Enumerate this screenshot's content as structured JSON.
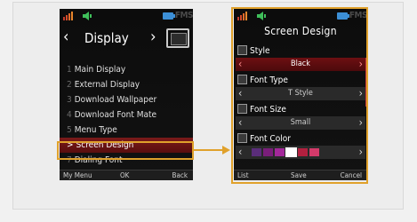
{
  "status": {
    "indicator": "FMS",
    "battery_icon": "battery-icon",
    "signal_icon": "signal-icon",
    "volume_icon": "speaker-icon"
  },
  "left": {
    "header": {
      "title": "Display",
      "prev_icon": "chevron-left-icon",
      "next_icon": "chevron-right-icon",
      "display_icon": "display-icon"
    },
    "menu": [
      {
        "num": "1",
        "label": "Main Display"
      },
      {
        "num": "2",
        "label": "External Display"
      },
      {
        "num": "3",
        "label": "Download Wallpaper"
      },
      {
        "num": "4",
        "label": "Download Font Mate"
      },
      {
        "num": "5",
        "label": "Menu Type"
      },
      {
        "num": ">",
        "label": "Screen Design",
        "selected": true
      },
      {
        "num": "7",
        "label": "Dialing Font"
      }
    ],
    "softkeys": {
      "left": "My Menu",
      "center": "OK",
      "right": "Back"
    }
  },
  "right": {
    "title": "Screen Design",
    "style": {
      "label": "Style",
      "value": "Black"
    },
    "font_type": {
      "label": "Font Type",
      "value": "T Style"
    },
    "font_size": {
      "label": "Font Size",
      "value": "Small"
    },
    "font_color": {
      "label": "Font Color",
      "colors": [
        "#5a2d7a",
        "#7a1e7a",
        "#a3289a",
        "#ffffff",
        "#b3203f",
        "#d43a6a"
      ],
      "selected_index": 3
    },
    "softkeys": {
      "left": "List",
      "center": "Save",
      "right": "Cancel"
    }
  },
  "colors": {
    "highlight": "#e0a12b",
    "selection": "#7a1a1a"
  }
}
